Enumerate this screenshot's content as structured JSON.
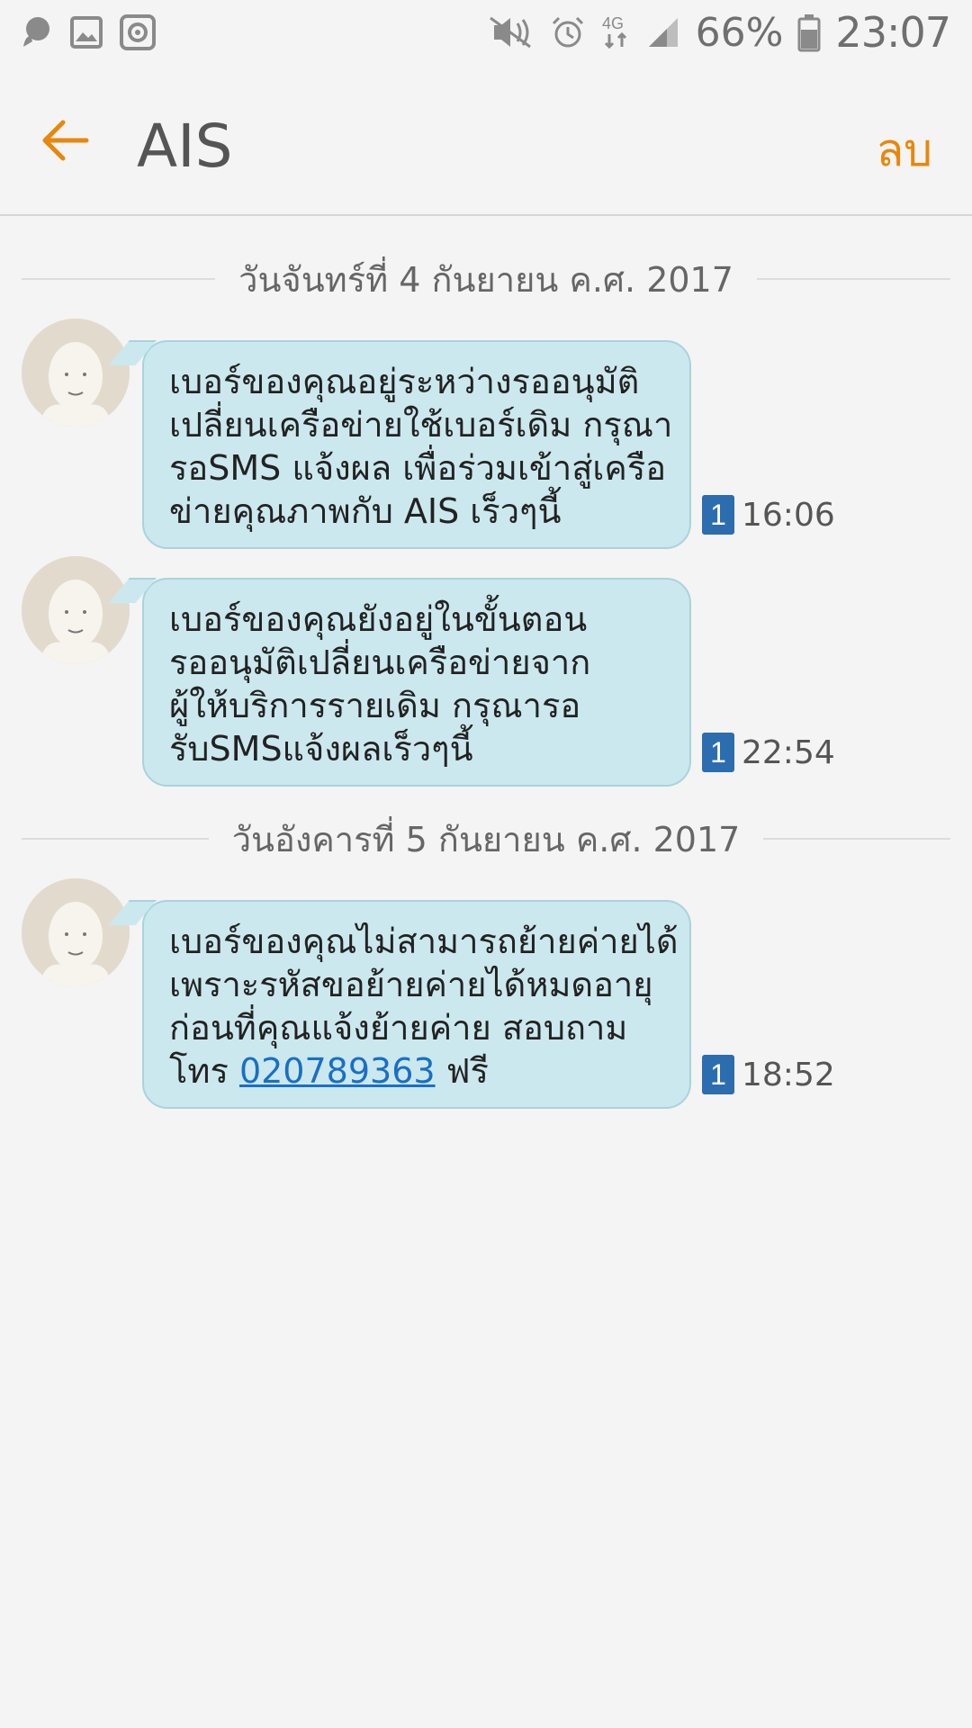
{
  "status_bar": {
    "battery_percent": "66%",
    "time": "23:07",
    "network": "4G",
    "icons_left": [
      "bubble-icon",
      "image-icon",
      "media-icon"
    ],
    "icons_right": [
      "mute-icon",
      "alarm-icon",
      "network-4g-icon",
      "signal-icon",
      "battery-icon"
    ]
  },
  "header": {
    "title": "AIS",
    "delete_label": "ลบ",
    "accent_color": "#e8870c"
  },
  "conversation": [
    {
      "date": "วันจันทร์ที่ 4 กันยายน ค.ศ. 2017",
      "messages": [
        {
          "lines": [
            "เบอร์ของคุณอยู่ระหว่างรออนุมัติ",
            "เปลี่ยนเครือข่ายใช้เบอร์เดิม กรุณา",
            "รอSMS แจ้งผล เพื่อร่วมเข้าสู่เครือ",
            "ข่ายคุณภาพกับ AIS เร็วๆนี้"
          ],
          "sim": "1",
          "time": "16:06"
        },
        {
          "lines": [
            "เบอร์ของคุณยังอยู่ในขั้นตอน",
            "รออนุมัติเปลี่ยนเครือข่ายจาก",
            "ผู้ให้บริการรายเดิม กรุณารอ",
            "รับSMSแจ้งผลเร็วๆนี้"
          ],
          "sim": "1",
          "time": "22:54"
        }
      ]
    },
    {
      "date": "วันอังคารที่ 5 กันยายน ค.ศ. 2017",
      "messages": [
        {
          "lines": [
            "เบอร์ของคุณไม่สามารถย้ายค่ายได้",
            "เพราะรหัสขอย้ายค่ายได้หมดอายุ",
            "ก่อนที่คุณแจ้งย้ายค่าย สอบถาม"
          ],
          "last_line_prefix": "โทร ",
          "phone": "020789363",
          "last_line_suffix": " ฟรี",
          "sim": "1",
          "time": "18:52"
        }
      ]
    }
  ]
}
